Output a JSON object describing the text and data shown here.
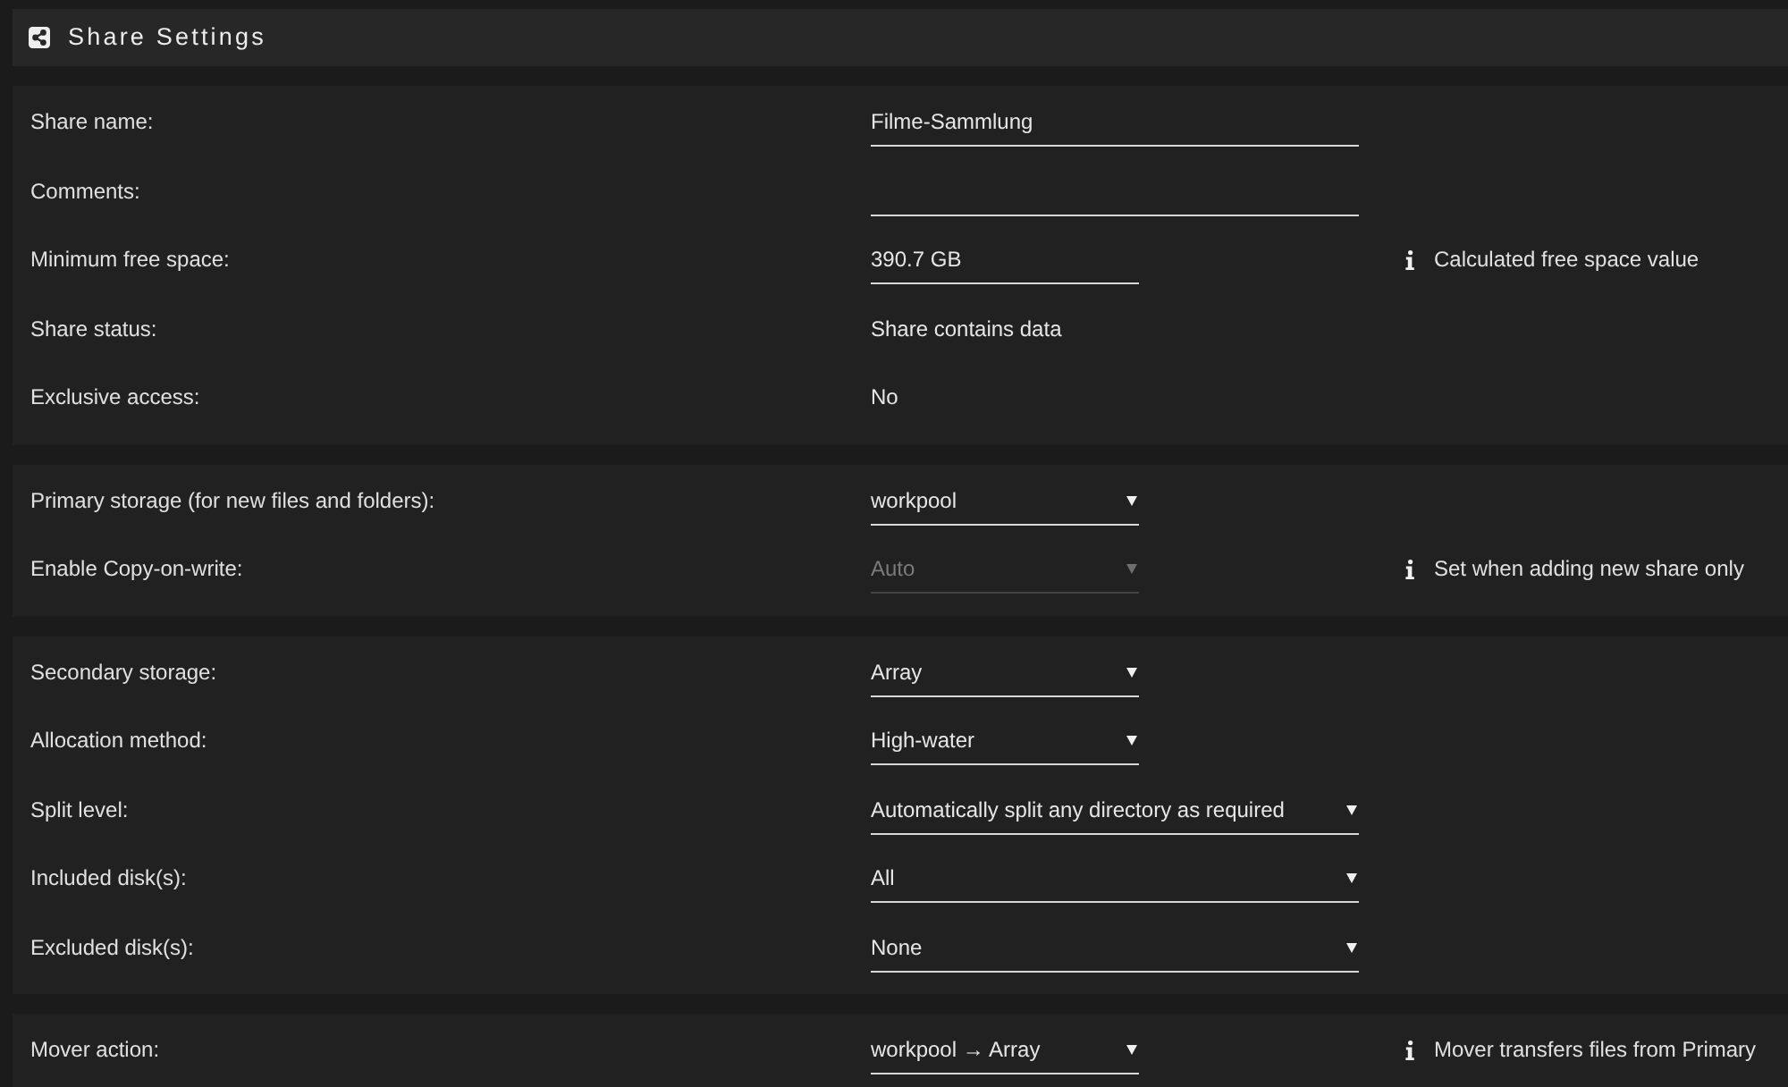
{
  "header": {
    "title": "Share Settings"
  },
  "sections": [
    {
      "rows": [
        {
          "label": "Share name:",
          "kind": "input",
          "value": "Filme-Sammlung",
          "disabled": false
        },
        {
          "label": "Comments:",
          "kind": "input",
          "disabled": false
        },
        {
          "label": "Minimum free space:",
          "kind": "shortinput",
          "value": "390.7 GB",
          "disabled": false,
          "note": "Calculated free space value"
        },
        {
          "label": "Share status:",
          "kind": "text",
          "value": "Share contains data"
        },
        {
          "label": "Exclusive access:",
          "kind": "text",
          "value": "No"
        }
      ]
    },
    {
      "rows": [
        {
          "label": "Primary storage (for new files and folders):",
          "kind": "select",
          "value": "workpool",
          "disabled": false
        },
        {
          "label": "Enable Copy-on-write:",
          "kind": "select",
          "value": "Auto",
          "disabled": true,
          "note": "Set when adding new share only"
        }
      ]
    },
    {
      "rows": [
        {
          "label": "Secondary storage:",
          "kind": "select",
          "value": "Array",
          "disabled": false
        },
        {
          "label": "Allocation method:",
          "kind": "select",
          "value": "High-water",
          "disabled": false
        },
        {
          "label": "Split level:",
          "kind": "wideselect",
          "value": "Automatically split any directory as required",
          "disabled": false
        },
        {
          "label": "Included disk(s):",
          "kind": "wideselect",
          "value": "All",
          "disabled": false
        },
        {
          "label": "Excluded disk(s):",
          "kind": "wideselect",
          "value": "None",
          "disabled": false
        }
      ]
    },
    {
      "rows": [
        {
          "label": "Mover action:",
          "kind": "select",
          "value": "workpool → Array",
          "disabled": false,
          "note": "Mover transfers files from Primary"
        }
      ]
    }
  ]
}
